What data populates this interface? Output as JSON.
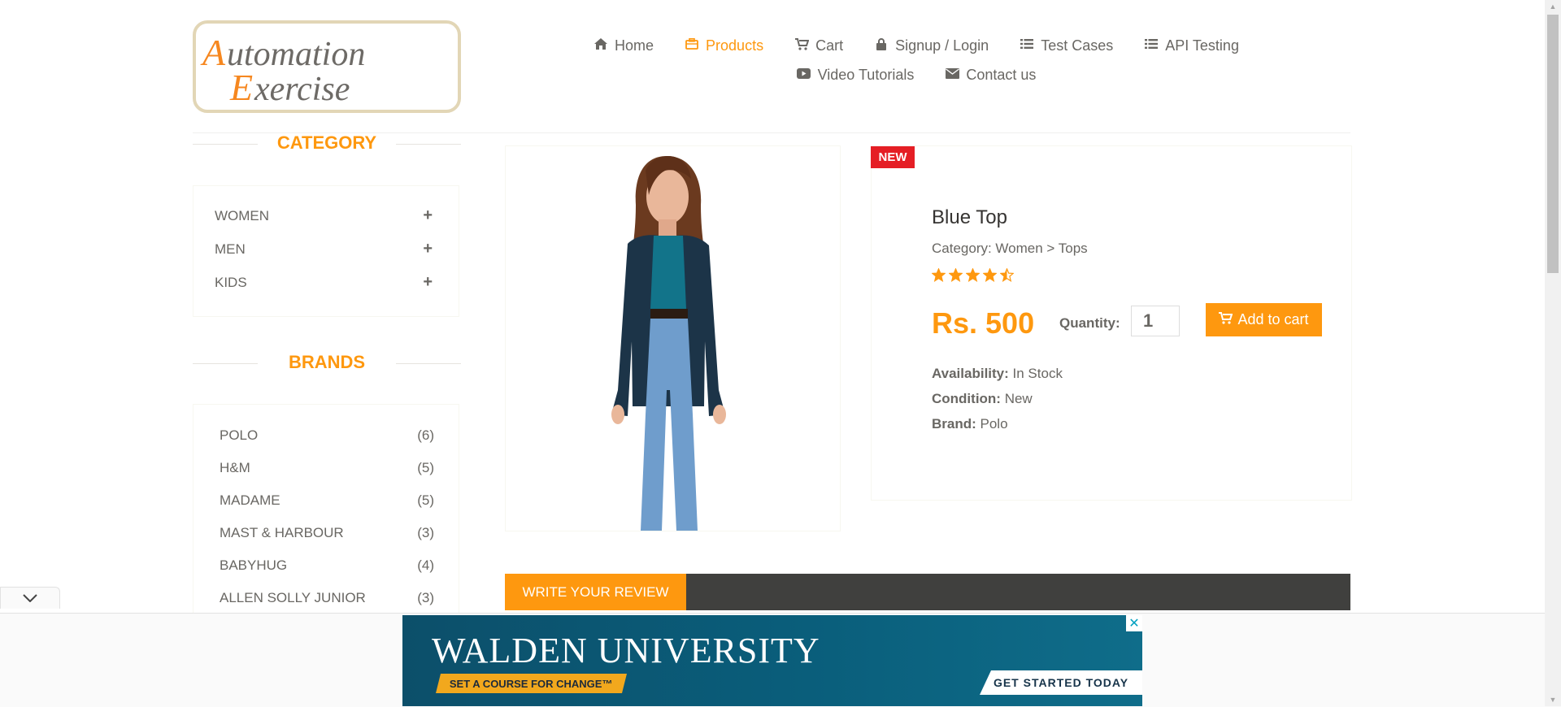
{
  "colors": {
    "accent": "#FE980F",
    "badge": "#E51E25",
    "dark_bar": "#40403E"
  },
  "logo": {
    "line1": "Automation",
    "line2": "Exercise"
  },
  "nav": {
    "row1": [
      {
        "label": "Home",
        "icon": "home-icon"
      },
      {
        "label": "Products",
        "icon": "products-icon",
        "active": true
      },
      {
        "label": "Cart",
        "icon": "cart-icon"
      },
      {
        "label": "Signup / Login",
        "icon": "lock-icon"
      },
      {
        "label": "Test Cases",
        "icon": "list-icon"
      },
      {
        "label": "API Testing",
        "icon": "list-icon"
      }
    ],
    "row2": [
      {
        "label": "Video Tutorials",
        "icon": "youtube-icon"
      },
      {
        "label": "Contact us",
        "icon": "envelope-icon"
      }
    ]
  },
  "sidebar": {
    "category_title": "CATEGORY",
    "categories": [
      "WOMEN",
      "MEN",
      "KIDS"
    ],
    "brands_title": "BRANDS",
    "brands": [
      {
        "name": "POLO",
        "count": "(6)"
      },
      {
        "name": "H&M",
        "count": "(5)"
      },
      {
        "name": "MADAME",
        "count": "(5)"
      },
      {
        "name": "MAST & HARBOUR",
        "count": "(3)"
      },
      {
        "name": "BABYHUG",
        "count": "(4)"
      },
      {
        "name": "ALLEN SOLLY JUNIOR",
        "count": "(3)"
      }
    ]
  },
  "product": {
    "badge": "NEW",
    "name": "Blue Top",
    "category": "Category: Women > Tops",
    "rating": 4.5,
    "price": "Rs. 500",
    "quantity_label": "Quantity:",
    "quantity_value": "1",
    "add_to_cart": "Add to cart",
    "availability_label": "Availability:",
    "availability": "In Stock",
    "condition_label": "Condition:",
    "condition": "New",
    "brand_label": "Brand:",
    "brand": "Polo"
  },
  "review": {
    "tab_label": "WRITE YOUR REVIEW"
  },
  "ad": {
    "title": "WALDEN UNIVERSITY",
    "tagline": "SET A COURSE FOR CHANGE™",
    "cta": "GET STARTED TODAY",
    "close": "✕"
  }
}
